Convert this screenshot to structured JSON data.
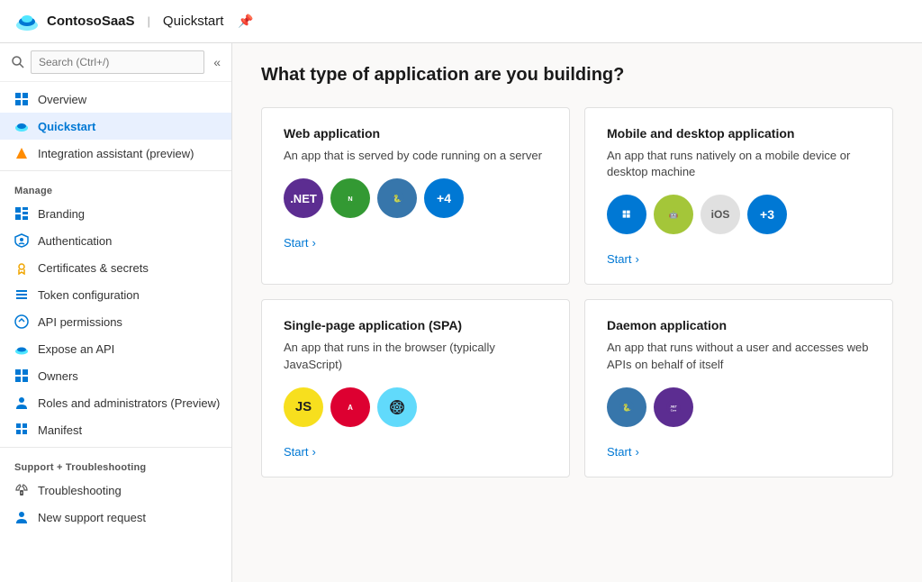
{
  "topbar": {
    "logo_alt": "Azure logo",
    "app_name": "ContosoSaaS",
    "divider": "|",
    "page_name": "Quickstart",
    "pin_icon": "📌"
  },
  "sidebar": {
    "search_placeholder": "Search (Ctrl+/)",
    "collapse_icon": "«",
    "nav_items": [
      {
        "id": "overview",
        "label": "Overview",
        "icon": "grid"
      },
      {
        "id": "quickstart",
        "label": "Quickstart",
        "icon": "cloud",
        "active": true
      },
      {
        "id": "integration",
        "label": "Integration assistant (preview)",
        "icon": "rocket"
      }
    ],
    "manage_label": "Manage",
    "manage_items": [
      {
        "id": "branding",
        "label": "Branding",
        "icon": "grid2"
      },
      {
        "id": "authentication",
        "label": "Authentication",
        "icon": "shield"
      },
      {
        "id": "certificates",
        "label": "Certificates & secrets",
        "icon": "key"
      },
      {
        "id": "token",
        "label": "Token configuration",
        "icon": "bars"
      },
      {
        "id": "api-permissions",
        "label": "API permissions",
        "icon": "arrow-circle"
      },
      {
        "id": "expose-api",
        "label": "Expose an API",
        "icon": "cloud2"
      },
      {
        "id": "owners",
        "label": "Owners",
        "icon": "grid3"
      },
      {
        "id": "roles",
        "label": "Roles and administrators (Preview)",
        "icon": "person"
      },
      {
        "id": "manifest",
        "label": "Manifest",
        "icon": "grid4"
      }
    ],
    "support_label": "Support + Troubleshooting",
    "support_items": [
      {
        "id": "troubleshooting",
        "label": "Troubleshooting",
        "icon": "wrench"
      },
      {
        "id": "new-support",
        "label": "New support request",
        "icon": "person2"
      }
    ]
  },
  "main": {
    "title": "What type of application are you building?",
    "cards": [
      {
        "id": "web-app",
        "title": "Web application",
        "desc": "An app that is served by code running on a server",
        "start_label": "Start",
        "icons": [
          {
            "type": "dotnet",
            "label": ".NET"
          },
          {
            "type": "nodejs",
            "label": "N"
          },
          {
            "type": "python",
            "label": "🐍"
          },
          {
            "type": "plus4",
            "label": "+4"
          }
        ]
      },
      {
        "id": "mobile-app",
        "title": "Mobile and desktop application",
        "desc": "An app that runs natively on a mobile device or desktop machine",
        "start_label": "Start",
        "icons": [
          {
            "type": "windows",
            "label": "⊞"
          },
          {
            "type": "android",
            "label": "🤖"
          },
          {
            "type": "ios",
            "label": "iOS"
          },
          {
            "type": "plus3",
            "label": "+3"
          }
        ]
      },
      {
        "id": "spa",
        "title": "Single-page application (SPA)",
        "desc": "An app that runs in the browser (typically JavaScript)",
        "start_label": "Start",
        "icons": [
          {
            "type": "js",
            "label": "JS"
          },
          {
            "type": "angular",
            "label": "A"
          },
          {
            "type": "react",
            "label": "⚛"
          }
        ]
      },
      {
        "id": "daemon",
        "title": "Daemon application",
        "desc": "An app that runs without a user and accesses web APIs on behalf of itself",
        "start_label": "Start",
        "icons": [
          {
            "type": "pycore",
            "label": "🐍"
          },
          {
            "type": "netcore",
            "label": ".NET Core"
          }
        ]
      }
    ]
  }
}
